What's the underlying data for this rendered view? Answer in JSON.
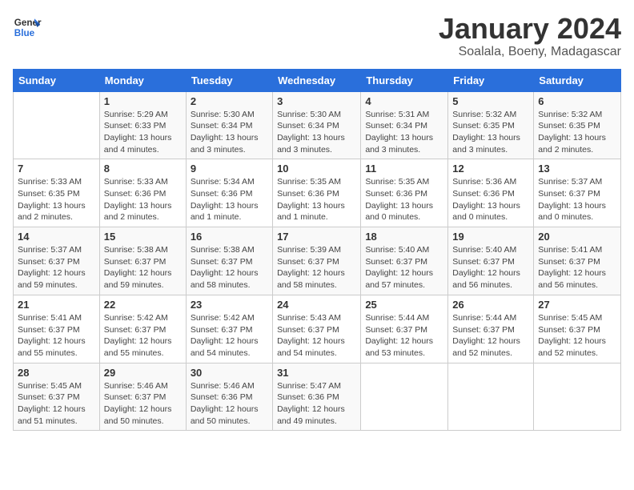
{
  "logo": {
    "general": "General",
    "blue": "Blue"
  },
  "header": {
    "month": "January 2024",
    "location": "Soalala, Boeny, Madagascar"
  },
  "weekdays": [
    "Sunday",
    "Monday",
    "Tuesday",
    "Wednesday",
    "Thursday",
    "Friday",
    "Saturday"
  ],
  "weeks": [
    [
      {
        "day": "",
        "info": ""
      },
      {
        "day": "1",
        "info": "Sunrise: 5:29 AM\nSunset: 6:33 PM\nDaylight: 13 hours\nand 4 minutes."
      },
      {
        "day": "2",
        "info": "Sunrise: 5:30 AM\nSunset: 6:34 PM\nDaylight: 13 hours\nand 3 minutes."
      },
      {
        "day": "3",
        "info": "Sunrise: 5:30 AM\nSunset: 6:34 PM\nDaylight: 13 hours\nand 3 minutes."
      },
      {
        "day": "4",
        "info": "Sunrise: 5:31 AM\nSunset: 6:34 PM\nDaylight: 13 hours\nand 3 minutes."
      },
      {
        "day": "5",
        "info": "Sunrise: 5:32 AM\nSunset: 6:35 PM\nDaylight: 13 hours\nand 3 minutes."
      },
      {
        "day": "6",
        "info": "Sunrise: 5:32 AM\nSunset: 6:35 PM\nDaylight: 13 hours\nand 2 minutes."
      }
    ],
    [
      {
        "day": "7",
        "info": "Sunrise: 5:33 AM\nSunset: 6:35 PM\nDaylight: 13 hours\nand 2 minutes."
      },
      {
        "day": "8",
        "info": "Sunrise: 5:33 AM\nSunset: 6:36 PM\nDaylight: 13 hours\nand 2 minutes."
      },
      {
        "day": "9",
        "info": "Sunrise: 5:34 AM\nSunset: 6:36 PM\nDaylight: 13 hours\nand 1 minute."
      },
      {
        "day": "10",
        "info": "Sunrise: 5:35 AM\nSunset: 6:36 PM\nDaylight: 13 hours\nand 1 minute."
      },
      {
        "day": "11",
        "info": "Sunrise: 5:35 AM\nSunset: 6:36 PM\nDaylight: 13 hours\nand 0 minutes."
      },
      {
        "day": "12",
        "info": "Sunrise: 5:36 AM\nSunset: 6:36 PM\nDaylight: 13 hours\nand 0 minutes."
      },
      {
        "day": "13",
        "info": "Sunrise: 5:37 AM\nSunset: 6:37 PM\nDaylight: 13 hours\nand 0 minutes."
      }
    ],
    [
      {
        "day": "14",
        "info": "Sunrise: 5:37 AM\nSunset: 6:37 PM\nDaylight: 12 hours\nand 59 minutes."
      },
      {
        "day": "15",
        "info": "Sunrise: 5:38 AM\nSunset: 6:37 PM\nDaylight: 12 hours\nand 59 minutes."
      },
      {
        "day": "16",
        "info": "Sunrise: 5:38 AM\nSunset: 6:37 PM\nDaylight: 12 hours\nand 58 minutes."
      },
      {
        "day": "17",
        "info": "Sunrise: 5:39 AM\nSunset: 6:37 PM\nDaylight: 12 hours\nand 58 minutes."
      },
      {
        "day": "18",
        "info": "Sunrise: 5:40 AM\nSunset: 6:37 PM\nDaylight: 12 hours\nand 57 minutes."
      },
      {
        "day": "19",
        "info": "Sunrise: 5:40 AM\nSunset: 6:37 PM\nDaylight: 12 hours\nand 56 minutes."
      },
      {
        "day": "20",
        "info": "Sunrise: 5:41 AM\nSunset: 6:37 PM\nDaylight: 12 hours\nand 56 minutes."
      }
    ],
    [
      {
        "day": "21",
        "info": "Sunrise: 5:41 AM\nSunset: 6:37 PM\nDaylight: 12 hours\nand 55 minutes."
      },
      {
        "day": "22",
        "info": "Sunrise: 5:42 AM\nSunset: 6:37 PM\nDaylight: 12 hours\nand 55 minutes."
      },
      {
        "day": "23",
        "info": "Sunrise: 5:42 AM\nSunset: 6:37 PM\nDaylight: 12 hours\nand 54 minutes."
      },
      {
        "day": "24",
        "info": "Sunrise: 5:43 AM\nSunset: 6:37 PM\nDaylight: 12 hours\nand 54 minutes."
      },
      {
        "day": "25",
        "info": "Sunrise: 5:44 AM\nSunset: 6:37 PM\nDaylight: 12 hours\nand 53 minutes."
      },
      {
        "day": "26",
        "info": "Sunrise: 5:44 AM\nSunset: 6:37 PM\nDaylight: 12 hours\nand 52 minutes."
      },
      {
        "day": "27",
        "info": "Sunrise: 5:45 AM\nSunset: 6:37 PM\nDaylight: 12 hours\nand 52 minutes."
      }
    ],
    [
      {
        "day": "28",
        "info": "Sunrise: 5:45 AM\nSunset: 6:37 PM\nDaylight: 12 hours\nand 51 minutes."
      },
      {
        "day": "29",
        "info": "Sunrise: 5:46 AM\nSunset: 6:37 PM\nDaylight: 12 hours\nand 50 minutes."
      },
      {
        "day": "30",
        "info": "Sunrise: 5:46 AM\nSunset: 6:36 PM\nDaylight: 12 hours\nand 50 minutes."
      },
      {
        "day": "31",
        "info": "Sunrise: 5:47 AM\nSunset: 6:36 PM\nDaylight: 12 hours\nand 49 minutes."
      },
      {
        "day": "",
        "info": ""
      },
      {
        "day": "",
        "info": ""
      },
      {
        "day": "",
        "info": ""
      }
    ]
  ]
}
